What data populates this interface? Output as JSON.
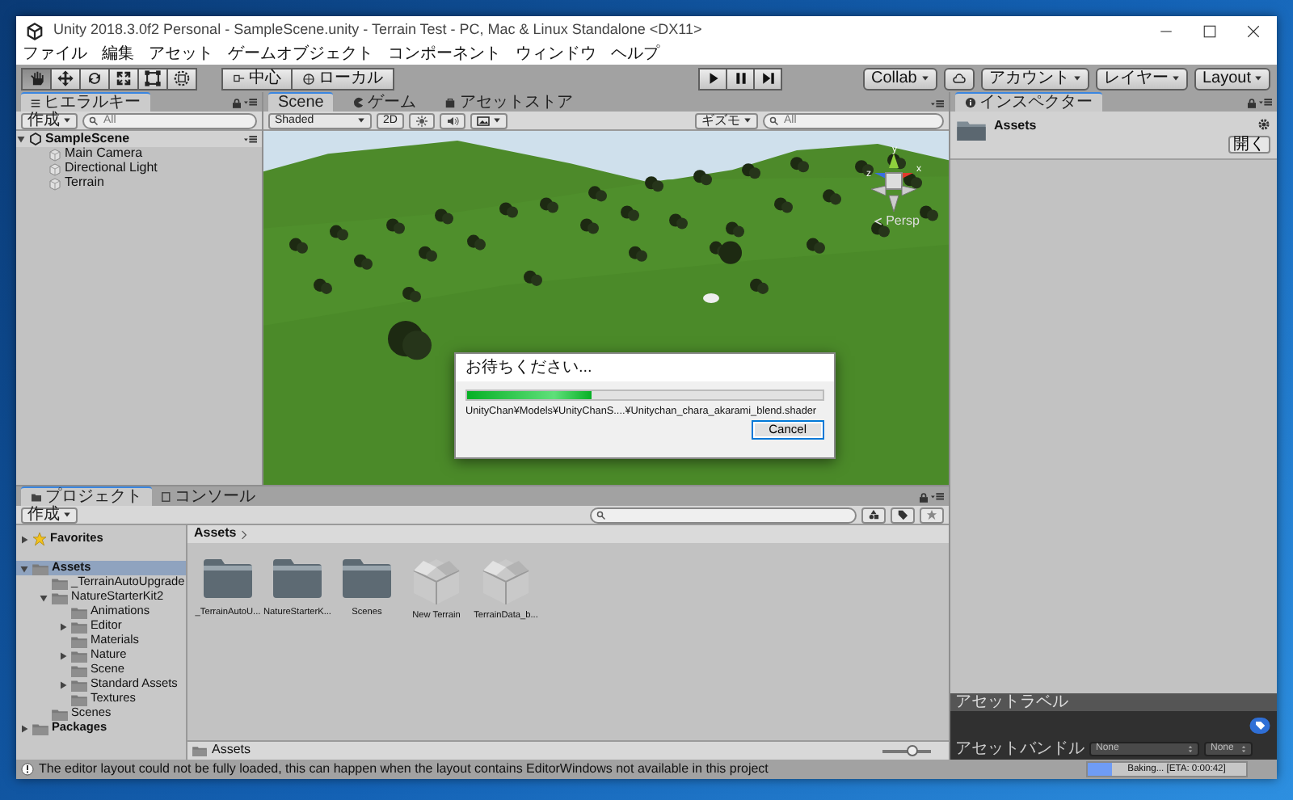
{
  "window": {
    "title": "Unity 2018.3.0f2 Personal - SampleScene.unity - Terrain Test - PC, Mac & Linux Standalone <DX11>"
  },
  "menu": [
    "ファイル",
    "編集",
    "アセット",
    "ゲームオブジェクト",
    "コンポーネント",
    "ウィンドウ",
    "ヘルプ"
  ],
  "toolbar": {
    "tools": [
      {
        "kind": "hand",
        "selected": true
      },
      {
        "kind": "move",
        "selected": false
      },
      {
        "kind": "rotate",
        "selected": false
      },
      {
        "kind": "scale",
        "selected": false
      },
      {
        "kind": "rect",
        "selected": false
      },
      {
        "kind": "transform",
        "selected": false
      }
    ],
    "pivot": [
      "中心",
      "ローカル"
    ],
    "right": [
      {
        "kind": "dropdown",
        "label": "Collab"
      },
      {
        "kind": "cloud"
      },
      {
        "kind": "dropdown",
        "label": "アカウント"
      },
      {
        "kind": "dropdown",
        "label": "レイヤー"
      },
      {
        "kind": "dropdown",
        "label": "Layout"
      }
    ]
  },
  "hierarchy": {
    "tab": "ヒエラルキー",
    "create": "作成",
    "search_placeholder": "All",
    "scene": {
      "name": "SampleScene",
      "expanded": true,
      "children": [
        {
          "name": "Main Camera"
        },
        {
          "name": "Directional Light"
        },
        {
          "name": "Terrain"
        }
      ]
    }
  },
  "scene_view": {
    "tabs": [
      {
        "kind": "scene",
        "label": "Scene",
        "selected": true
      },
      {
        "kind": "game",
        "label": "ゲーム",
        "selected": false
      },
      {
        "kind": "store",
        "label": "アセットストア",
        "selected": false
      }
    ],
    "shading": "Shaded",
    "mode_2d": "2D",
    "gizmos": "ギズモ",
    "search_placeholder": "All",
    "axis_labels": [
      "y",
      "z",
      "x"
    ],
    "projection": "Persp"
  },
  "progress_dialog": {
    "title": "お待ちください...",
    "level": 0.35,
    "file": "UnityChan¥Models¥UnityChanS....¥Unitychan_chara_akarami_blend.shader",
    "button": "Cancel"
  },
  "inspector": {
    "tab": "インスペクター",
    "asset": "Assets",
    "open_button": "開く",
    "labels_header": "アセットラベル",
    "bundle_label": "アセットバンドル",
    "bundle_values": [
      "None",
      "None"
    ]
  },
  "project": {
    "tabs": [
      {
        "label": "プロジェクト",
        "selected": true
      },
      {
        "label": "コンソール",
        "selected": false
      }
    ],
    "create": "作成",
    "tree": [
      {
        "name": "Favorites",
        "kind": "favorites",
        "expanded": false,
        "selected": false
      },
      {
        "name": "Assets",
        "kind": "folder",
        "expanded": true,
        "selected": true,
        "children": [
          {
            "name": "_TerrainAutoUpgrade",
            "kind": "folder",
            "selected": false
          },
          {
            "name": "NatureStarterKit2",
            "kind": "folder",
            "expanded": true,
            "selected": false,
            "children": [
              {
                "name": "Animations",
                "kind": "folder",
                "selected": false
              },
              {
                "name": "Editor",
                "kind": "folder",
                "expanded": false,
                "selected": false
              },
              {
                "name": "Materials",
                "kind": "folder",
                "selected": false
              },
              {
                "name": "Nature",
                "kind": "folder",
                "expanded": false,
                "selected": false
              },
              {
                "name": "Scene",
                "kind": "folder",
                "selected": false
              },
              {
                "name": "Standard Assets",
                "kind": "folder",
                "expanded": false,
                "selected": false
              },
              {
                "name": "Textures",
                "kind": "folder",
                "selected": false
              }
            ]
          },
          {
            "name": "Scenes",
            "kind": "folder",
            "selected": false
          }
        ]
      },
      {
        "name": "Packages",
        "kind": "folder",
        "expanded": false,
        "selected": false
      }
    ],
    "breadcrumb": "Assets",
    "items": [
      {
        "name": "_TerrainAutoU...",
        "kind": "folder"
      },
      {
        "name": "NatureStarterK...",
        "kind": "folder"
      },
      {
        "name": "Scenes",
        "kind": "folder"
      },
      {
        "name": "New Terrain",
        "kind": "prefab"
      },
      {
        "name": "TerrainData_b...",
        "kind": "prefab"
      }
    ],
    "footer_path": "Assets",
    "zoom": {
      "level": 0.6
    }
  },
  "status_bar": {
    "message": "The editor layout could not be fully loaded, this can happen when the layout contains EditorWindows not available in this project",
    "baking": {
      "text": "Baking... [ETA: 0:00:42]",
      "level": 0.15
    }
  }
}
